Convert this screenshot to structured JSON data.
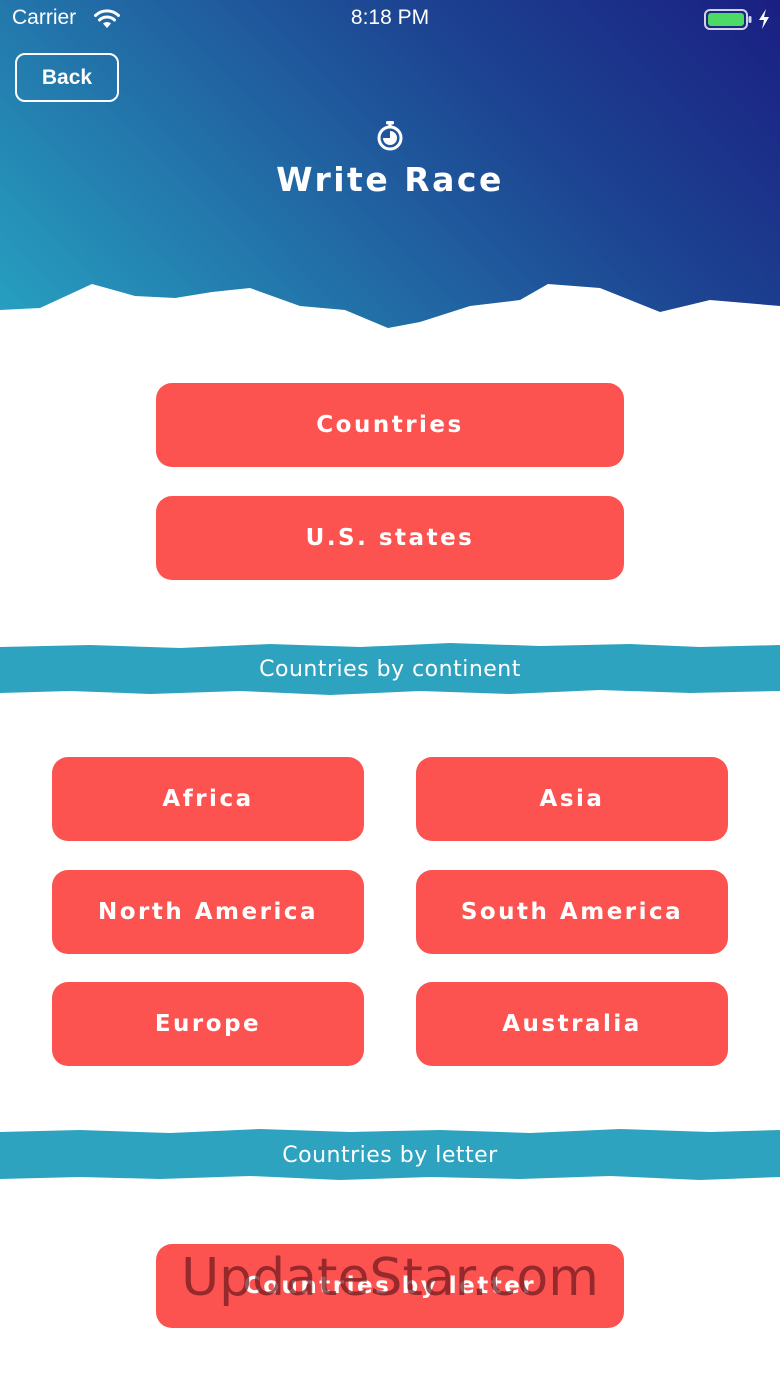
{
  "status_bar": {
    "carrier": "Carrier",
    "time": "8:18 PM"
  },
  "nav": {
    "back_label": "Back"
  },
  "header": {
    "icon": "stopwatch-icon",
    "title": "Write Race"
  },
  "main_buttons": {
    "countries": "Countries",
    "us_states": "U.S. states"
  },
  "continent_section": {
    "heading": "Countries by continent",
    "buttons": [
      "Africa",
      "Asia",
      "North America",
      "South America",
      "Europe",
      "Australia"
    ]
  },
  "letter_section": {
    "heading": "Countries by letter",
    "button": "Countries by letter"
  },
  "watermark": "UpdateStar.com",
  "colors": {
    "button": "#fc5351",
    "banner": "#2ea3bf",
    "header_start": "#27a3c2",
    "header_end": "#1a1f82"
  }
}
